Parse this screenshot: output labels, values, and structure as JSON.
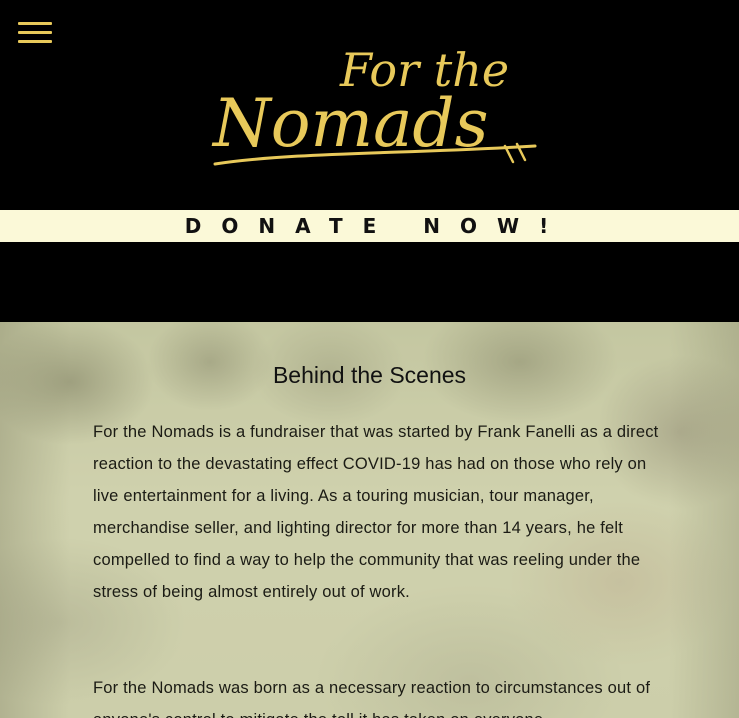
{
  "header": {
    "menu_icon": "hamburger-menu-icon",
    "logo": {
      "line1": "For the",
      "line2": "Nomads",
      "color": "#e8c95a"
    }
  },
  "donate": {
    "label": "DONATE NOW!",
    "background": "#fbf9d8"
  },
  "section": {
    "title": "Behind the Scenes",
    "paragraphs": [
      "For the Nomads is a fundraiser that was started by Frank Fanelli as a direct reaction to the devastating effect COVID-19 has had on those who rely on live entertainment for a living. As a touring musician, tour manager, merchandise seller, and lighting director for more than 14 years, he felt compelled to find a way to help the community that was reeling under the stress of being almost entirely out of work.",
      "For the Nomads was born as a necessary reaction to circumstances out of anyone's control to mitigate the toll it has taken on everyone"
    ]
  }
}
